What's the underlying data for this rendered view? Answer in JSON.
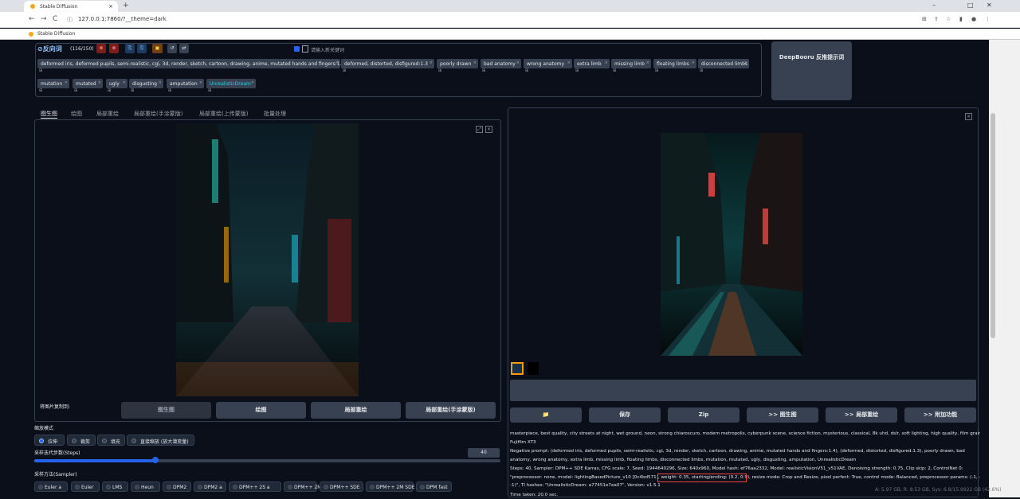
{
  "browser": {
    "tab_title": "Stable Diffusion",
    "url": "127.0.0.1:7860/?__theme=dark",
    "bookmark": "Stable Diffusion",
    "new_tab": "+",
    "tab_close": "×",
    "window_minimize": "–",
    "window_maximize": "□",
    "window_close": "✕"
  },
  "negative": {
    "header": "反向词",
    "count": "(116/150)",
    "new_keyword_placeholder": "请输入新关键词",
    "tags": [
      {
        "text": "deformed iris, deformed pupils, semi-realistic, cgi, 3d, render, sketch, cartoon, drawing, anime, mutated hands and fingers:1.4"
      },
      {
        "text": "deformed, distorted, disfigured:1.3"
      },
      {
        "text": "poorly drawn"
      },
      {
        "text": "bad anatomy"
      },
      {
        "text": "wrong anatomy"
      },
      {
        "text": "extra limb"
      },
      {
        "text": "missing limb"
      },
      {
        "text": "floating limbs"
      },
      {
        "text": "disconnected limbs"
      },
      {
        "text": "mutation"
      },
      {
        "text": "mutated"
      },
      {
        "text": "ugly"
      },
      {
        "text": "disgusting"
      },
      {
        "text": "amputation"
      },
      {
        "text": "UnrealisticDream"
      }
    ],
    "sub_glyph": "⊞"
  },
  "deepbooru_button": "DeepBooru 反推提示词",
  "tabs": [
    "图生图",
    "绘图",
    "局部重绘",
    "局部重绘(手涂蒙版)",
    "局部重绘(上传蒙版)",
    "批量处理"
  ],
  "copy_label": "将图片复制到:",
  "copy_buttons": [
    "图生图",
    "绘图",
    "局部重绘",
    "局部重绘(手涂蒙版)"
  ],
  "resize_label": "缩放模式",
  "resize_options": [
    "拉伸",
    "裁剪",
    "填充",
    "直接缩放 (放大潜变量)"
  ],
  "steps_label": "采样迭代步数(Steps)",
  "steps_value": "40",
  "steps_fraction": 0.26,
  "sampler_label": "采样方法(Sampler)",
  "samplers": [
    "Euler a",
    "Euler",
    "LMS",
    "Heun",
    "DPM2",
    "DPM2 a",
    "DPM++ 2S a",
    "DPM++ 2M",
    "DPM++ SDE",
    "DPM++ 2M SDE",
    "DPM fast"
  ],
  "output_buttons": [
    "📁",
    "保存",
    "Zip",
    ">> 图生图",
    ">> 局部重绘",
    ">> 附加功能"
  ],
  "info_lines": [
    "masterpiece, best quality, city streets at night, wet ground, neon, strong chiaroscuro, modern metropolis, cyberpunk scene, science fiction, mysterious, classical, 8k uhd, dslr, soft lighting, high quality, film grain,",
    "Fujifilm XT3",
    "Negative prompt: (deformed iris, deformed pupils, semi-realistic, cgi, 3d, render, sketch, cartoon, drawing, anime, mutated hands and fingers:1.4), (deformed, distorted, disfigured:1.3), poorly drawn, bad",
    "anatomy, wrong anatomy, extra limb, missing limb, floating limbs, disconnected limbs, mutation, mutated, ugly, disgusting, amputation, UnrealisticDream",
    "Steps: 40, Sampler: DPM++ SDE Karras, CFG scale: 7, Seed: 1944640296, Size: 640x960, Model hash: ef76aa2332, Model: realisticVisionV51_v51VAE, Denoising strength: 0.75, Clip skip: 2, ControlNet 0:",
    "\"preprocessor: none, model: lightingBasedPicture_v10 [0c4bd571], weight: 0.35, starting/ending: (0.2, 0.9), resize mode: Crop and Resize, pixel perfect: True, control mode: Balanced, preprocessor params: (-1, -1,",
    "-1)\", TI hashes: \"UnrealisticDream: a77451e7ea07\", Version: v1.5.1",
    "Time taken: 20.0 sec."
  ],
  "watermark": "A: 5.97 GB, R: 8.53 GB, Sys: 6.8/15.9922 GB (42.6%)",
  "colors": {
    "accent": "#2563eb",
    "highlight_box": "#ef4444",
    "bg": "#0b0f19"
  }
}
